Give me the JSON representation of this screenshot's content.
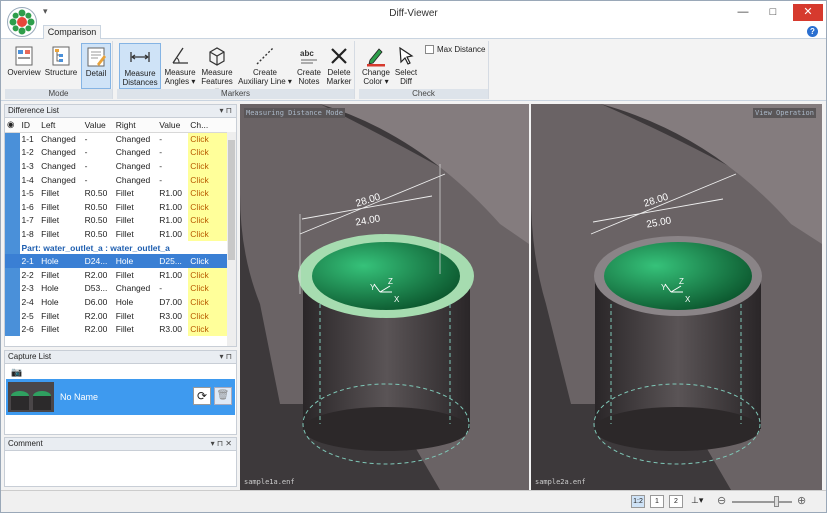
{
  "window": {
    "title": "Diff-Viewer",
    "qat": "▾",
    "minimize": "—",
    "maximize": "□",
    "close": "✕",
    "help": "?"
  },
  "tabs": [
    {
      "label": "Comparison"
    }
  ],
  "ribbon": {
    "mode": {
      "label": "Mode",
      "buttons": [
        "Overview",
        "Structure",
        "Detail"
      ]
    },
    "markers": {
      "label": "Markers",
      "buttons": [
        {
          "line1": "Measure",
          "line2": "Distances ▾"
        },
        {
          "line1": "Measure",
          "line2": "Angles ▾"
        },
        {
          "line1": "Measure",
          "line2": "Features ▾"
        },
        {
          "line1": "Create",
          "line2": "Auxiliary Line ▾"
        },
        {
          "line1": "Create",
          "line2": "Notes"
        },
        {
          "line1": "Delete",
          "line2": "Marker"
        }
      ]
    },
    "check": {
      "label": "Check",
      "buttons": [
        {
          "line1": "Change",
          "line2": "Color ▾"
        },
        {
          "line1": "Select",
          "line2": "Diff"
        }
      ],
      "max_distance_label": "Max Distance"
    }
  },
  "difference_list": {
    "title": "Difference List",
    "columns": [
      "ID",
      "Left",
      "Value",
      "Right",
      "Value",
      "Ch..."
    ],
    "rows_a": [
      [
        "1-1",
        "Changed",
        "-",
        "Changed",
        "-",
        "Click"
      ],
      [
        "1-2",
        "Changed",
        "-",
        "Changed",
        "-",
        "Click"
      ],
      [
        "1-3",
        "Changed",
        "-",
        "Changed",
        "-",
        "Click"
      ],
      [
        "1-4",
        "Changed",
        "-",
        "Changed",
        "-",
        "Click"
      ],
      [
        "1-5",
        "Fillet",
        "R0.50",
        "Fillet",
        "R1.00",
        "Click"
      ],
      [
        "1-6",
        "Fillet",
        "R0.50",
        "Fillet",
        "R1.00",
        "Click"
      ],
      [
        "1-7",
        "Fillet",
        "R0.50",
        "Fillet",
        "R1.00",
        "Click"
      ],
      [
        "1-8",
        "Fillet",
        "R0.50",
        "Fillet",
        "R1.00",
        "Click"
      ]
    ],
    "part_label": "Part: water_outlet_a : water_outlet_a",
    "rows_b": [
      [
        "2-1",
        "Hole",
        "D24...",
        "Hole",
        "D25...",
        "Click"
      ],
      [
        "2-2",
        "Fillet",
        "R2.00",
        "Fillet",
        "R1.00",
        "Click"
      ],
      [
        "2-3",
        "Hole",
        "D53...",
        "Changed",
        "-",
        "Click"
      ],
      [
        "2-4",
        "Hole",
        "D6.00",
        "Hole",
        "D7.00",
        "Click"
      ],
      [
        "2-5",
        "Fillet",
        "R2.00",
        "Fillet",
        "R3.00",
        "Click"
      ],
      [
        "2-6",
        "Fillet",
        "R2.00",
        "Fillet",
        "R3.00",
        "Click"
      ]
    ]
  },
  "capture_list": {
    "title": "Capture List",
    "item_name": "No Name"
  },
  "comment": {
    "title": "Comment"
  },
  "panel_controls": "▾ ⊓",
  "viewports": {
    "left": {
      "mode_label": "Measuring Distance Mode",
      "file": "sample1a.enf",
      "dim1": "28.00",
      "dim2": "24.00"
    },
    "right": {
      "mode_label": "View Operation",
      "file": "sample2a.enf",
      "dim1": "28.00",
      "dim2": "25.00"
    }
  },
  "status": {
    "buttons": [
      "1:2",
      "1",
      "2"
    ]
  }
}
